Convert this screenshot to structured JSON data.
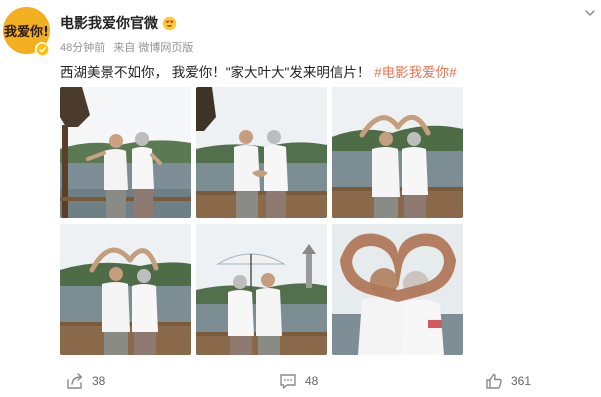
{
  "account": {
    "name": "电影我爱你官微",
    "avatar_text": "我爱你!",
    "name_badge_icon": "heart-eyes-emoji-icon",
    "verified_icon": "verified-check-icon"
  },
  "meta": {
    "time": "48分钟前",
    "source": "来自 微博网页版"
  },
  "post": {
    "text": "西湖美景不如你， 我爱你！\"家大叶大\"发来明信片！",
    "hashtag": "#电影我爱你#"
  },
  "photos": [
    {
      "name": "couple-heart-hands-boat"
    },
    {
      "name": "couple-heart-hands-lake"
    },
    {
      "name": "couple-arms-heart-overhead"
    },
    {
      "name": "couple-arms-heart-boat-deck"
    },
    {
      "name": "couple-under-parasol"
    },
    {
      "name": "finger-heart-frame-closeup"
    }
  ],
  "actions": {
    "share": {
      "icon": "share-icon",
      "count": "38"
    },
    "comment": {
      "icon": "comment-icon",
      "count": "48"
    },
    "like": {
      "icon": "thumbs-up-icon",
      "count": "361"
    }
  },
  "colors": {
    "hashtag": "#eb7350",
    "meta": "#939393",
    "verified": "#ffc107",
    "avatar_bg": "#f2b020"
  }
}
